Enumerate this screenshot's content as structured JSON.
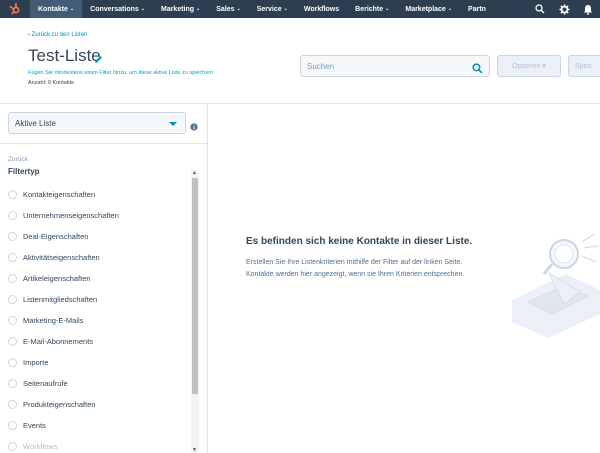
{
  "nav": {
    "items": [
      {
        "label": "Kontakte",
        "caret": "⌄"
      },
      {
        "label": "Conversations",
        "caret": "⌄"
      },
      {
        "label": "Marketing",
        "caret": "⌄"
      },
      {
        "label": "Sales",
        "caret": "⌄"
      },
      {
        "label": "Service",
        "caret": "⌄"
      },
      {
        "label": "Workflows",
        "caret": ""
      },
      {
        "label": "Berichte",
        "caret": "⌄"
      },
      {
        "label": "Marketplace",
        "caret": "⌄"
      },
      {
        "label": "Partn",
        "caret": ""
      }
    ],
    "bg": "#2d3e50",
    "active_bg": "#425b76",
    "icons": [
      "sprocket-logo-icon",
      "search-icon",
      "gear-icon",
      "bell-icon"
    ]
  },
  "header": {
    "back_link": "‹ Zurück zu den Listen",
    "title": "Test-Liste",
    "hint": "Fügen Sie mindestens einen Filter hinzu, um diese aktive Liste zu speichern",
    "count": "Anzahl: 0 Kontakte",
    "search_placeholder": "Suchen",
    "options_label": "Optionen ▾",
    "save_label": "Speic"
  },
  "sidebar": {
    "list_type": "Aktive Liste",
    "back": "Zurück",
    "filter_heading": "Filtertyp",
    "filters": [
      "Kontakteigenschaften",
      "Unternehmenseigenschaften",
      "Deal-Eigenschaften",
      "Aktivitätseigenschaften",
      "Artikeleigenschaften",
      "Listenmitgliedschaften",
      "Marketing-E-Mails",
      "E-Mail-Abonnements",
      "Importe",
      "Seitenaufrufe",
      "Produkteigenschaften",
      "Events",
      "Workflows"
    ]
  },
  "empty_state": {
    "title": "Es befinden sich keine Kontakte in dieser Liste.",
    "text": "Erstellen Sie Ihre Listenkriterien mithilfe der Filter auf der linken Seite. Kontakte werden hier angezeigt, wenn sie Ihren Kriterien entsprechen."
  },
  "colors": {
    "accent": "#0091ae",
    "hint": "#00a4bd",
    "text": "#33475b",
    "border": "#dfe3eb"
  }
}
